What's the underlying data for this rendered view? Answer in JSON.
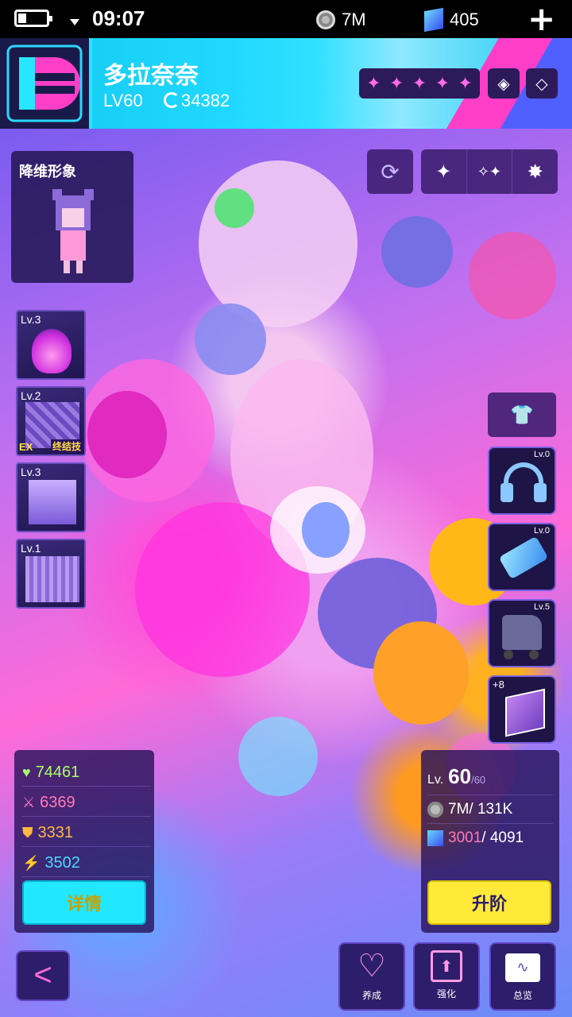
{
  "status": {
    "time": "09:07",
    "coins": "7M",
    "gems": "405",
    "add": "+"
  },
  "character": {
    "name": "多拉奈奈",
    "level": "LV60",
    "power": "34382",
    "stars": 5
  },
  "sprite_panel": {
    "title": "降维形象"
  },
  "skills": [
    {
      "level": "Lv.3"
    },
    {
      "level": "Lv.2",
      "badge_left": "EX",
      "badge_right": "终结技"
    },
    {
      "level": "Lv.3"
    },
    {
      "level": "Lv.1"
    }
  ],
  "equipment": [
    {
      "level": "Lv.0",
      "icon": "headphones-icon"
    },
    {
      "level": "Lv.0",
      "icon": "battery-icon"
    },
    {
      "level": "Lv.5",
      "icon": "roller-skate-icon"
    },
    {
      "level": "+8",
      "icon": "book-icon"
    }
  ],
  "stats": {
    "hp": "74461",
    "attack": "6369",
    "defense": "3331",
    "speed": "3502",
    "details_label": "详情",
    "colors": {
      "hp": "#a6ff6a",
      "attack": "#ff7ab8",
      "defense": "#ffb840",
      "speed": "#4ad8ff"
    }
  },
  "upgrade": {
    "lv_label": "Lv.",
    "level": "60",
    "max": "/60",
    "coins": "7M/ 131K",
    "cubes_have": "3001",
    "cubes_need": "/ 4091",
    "button_label": "升阶"
  },
  "nav": {
    "back": "<",
    "train": "养成",
    "enhance": "强化",
    "overview": "总览"
  }
}
